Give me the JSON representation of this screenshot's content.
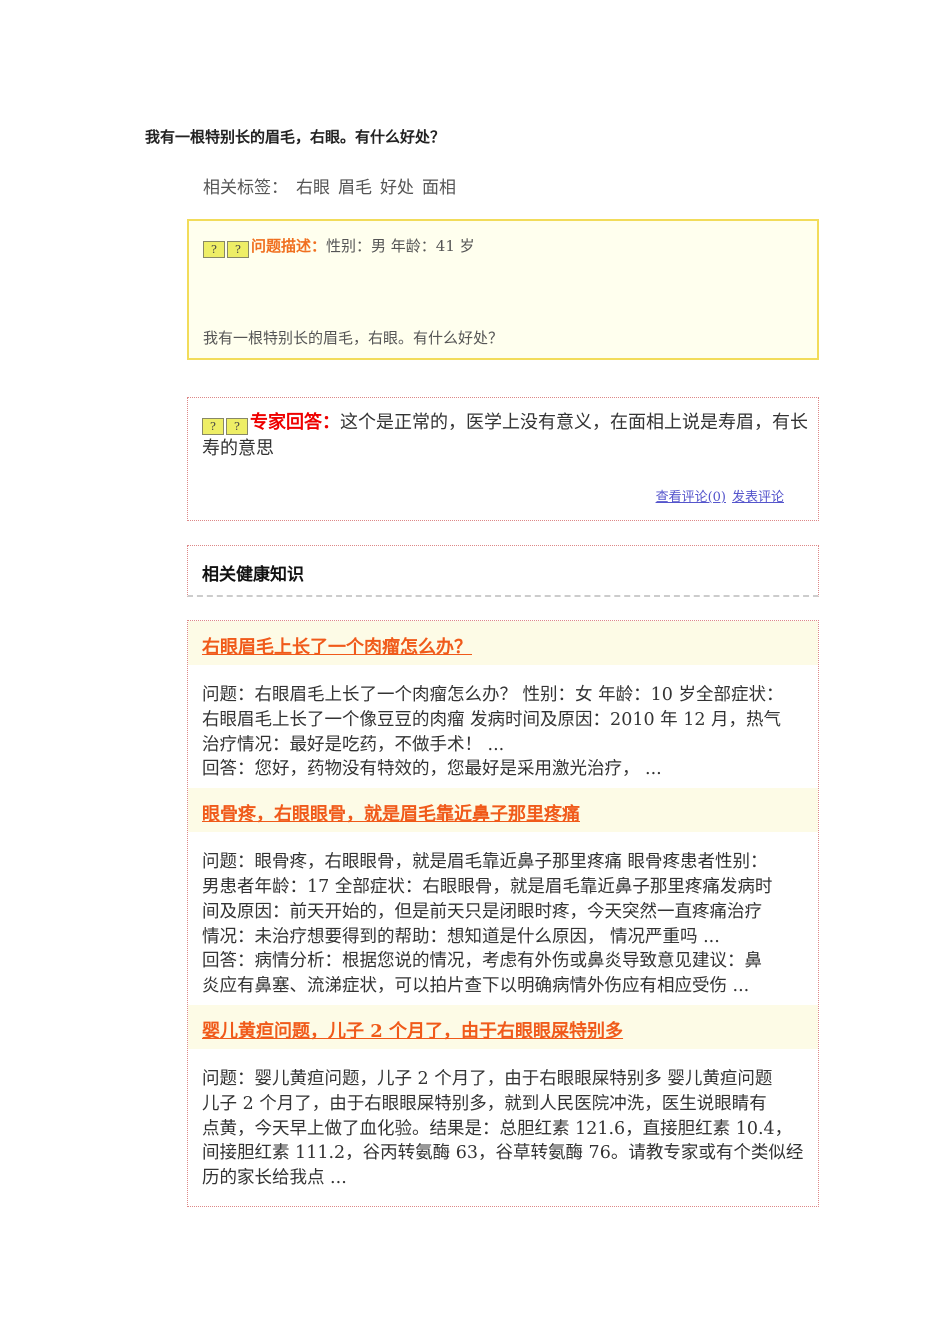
{
  "title": "我有一根特别长的眉毛，右眼。有什么好处？",
  "tags": {
    "label": "相关标签：",
    "items": [
      "右眼",
      "眉毛",
      "好处",
      "面相"
    ]
  },
  "question": {
    "label": "问题描述：",
    "meta": "性别：男  年龄：41 岁",
    "text": "我有一根特别长的眉毛，右眼。有什么好处？"
  },
  "answer": {
    "label": "专家回答：",
    "text": "这个是正常的，医学上没有意义，在面相上说是寿眉，有长寿的意思",
    "view_comments": "查看评论(0)",
    "post_comment": "发表评论"
  },
  "knowledge": {
    "heading": "相关健康知识"
  },
  "related": [
    {
      "title": "右眼眉毛上长了一个肉瘤怎么办？",
      "lines": [
        "问题：右眼眉毛上长了一个肉瘤怎么办？  性别：女  年龄：10 岁全部症状：",
        "右眼眉毛上长了一个像豆豆的肉瘤  发病时间及原因：2010 年 12 月，热气",
        "治疗情况：最好是吃药，不做手术！  ...",
        "回答：您好，药物没有特效的，您最好是采用激光治疗，  ..."
      ]
    },
    {
      "title": "眼骨疼，右眼眼骨，就是眉毛靠近鼻子那里疼痛",
      "lines": [
        "问题：眼骨疼，右眼眼骨，就是眉毛靠近鼻子那里疼痛  眼骨疼患者性别：",
        "男患者年龄：17  全部症状：右眼眼骨，就是眉毛靠近鼻子那里疼痛发病时",
        "间及原因：前天开始的，但是前天只是闭眼时疼，今天突然一直疼痛治疗",
        "情况：未治疗想要得到的帮助：想知道是什么原因，  情况严重吗 ...",
        "回答：病情分析：根据您说的情况，考虑有外伤或鼻炎导致意见建议：鼻",
        "炎应有鼻塞、流涕症状，可以拍片查下以明确病情外伤应有相应受伤 ..."
      ]
    },
    {
      "title": "婴儿黄疸问题，儿子 2 个月了，由于右眼眼屎特别多",
      "lines": [
        "问题：婴儿黄疸问题，儿子 2 个月了，由于右眼眼屎特别多  婴儿黄疸问题",
        "儿子 2 个月了，由于右眼眼屎特别多，就到人民医院冲洗，医生说眼睛有",
        "点黄，今天早上做了血化验。结果是：总胆红素 121.6，直接胆红素 10.4，",
        "间接胆红素 111.2，谷丙转氨酶 63，谷草转氨酶 76。请教专家或有个类似经",
        "历的家长给我点 ..."
      ]
    }
  ]
}
